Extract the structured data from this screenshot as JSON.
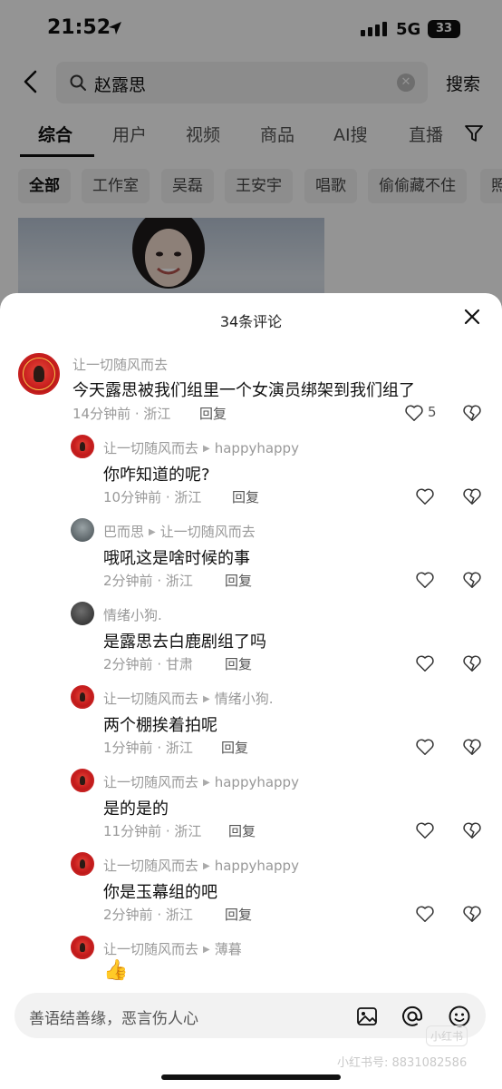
{
  "status": {
    "time": "21:52",
    "network": "5G",
    "battery": "33"
  },
  "search": {
    "query": "赵露思",
    "button": "搜索"
  },
  "tabs": [
    "综合",
    "用户",
    "视频",
    "商品",
    "AI搜",
    "直播"
  ],
  "chips": [
    "全部",
    "工作室",
    "吴磊",
    "王安宇",
    "唱歌",
    "偷偷藏不住",
    "照"
  ],
  "sheet": {
    "title": "34条评论"
  },
  "comments": [
    {
      "user": "让一切随风而去",
      "reply_to": "",
      "text": "今天露思被我们组里一个女演员绑架到我们组了",
      "time": "14分钟前",
      "location": "浙江",
      "reply": "回复",
      "likes": "5"
    },
    {
      "user": "让一切随风而去",
      "reply_to": "happyhappy",
      "text": "你咋知道的呢?",
      "time": "10分钟前",
      "location": "浙江",
      "reply": "回复"
    },
    {
      "user": "巴而思",
      "reply_to": "让一切随风而去",
      "text": "哦吼这是啥时候的事",
      "time": "2分钟前",
      "location": "浙江",
      "reply": "回复"
    },
    {
      "user": "情绪小狗.",
      "reply_to": "",
      "text": "是露思去白鹿剧组了吗",
      "time": "2分钟前",
      "location": "甘肃",
      "reply": "回复"
    },
    {
      "user": "让一切随风而去",
      "reply_to": "情绪小狗.",
      "text": "两个棚挨着拍呢",
      "time": "1分钟前",
      "location": "浙江",
      "reply": "回复"
    },
    {
      "user": "让一切随风而去",
      "reply_to": "happyhappy",
      "text": "是的是的",
      "time": "11分钟前",
      "location": "浙江",
      "reply": "回复"
    },
    {
      "user": "让一切随风而去",
      "reply_to": "happyhappy",
      "text": "你是玉幕组的吧",
      "time": "2分钟前",
      "location": "浙江",
      "reply": "回复"
    },
    {
      "user": "让一切随风而去",
      "reply_to": "薄暮",
      "text": "",
      "time": "",
      "location": "",
      "reply": ""
    }
  ],
  "input": {
    "placeholder": "善语结善缘，恶言伤人心"
  },
  "watermark": {
    "text": "小红书号: 8831082586",
    "logo": "小红书"
  }
}
